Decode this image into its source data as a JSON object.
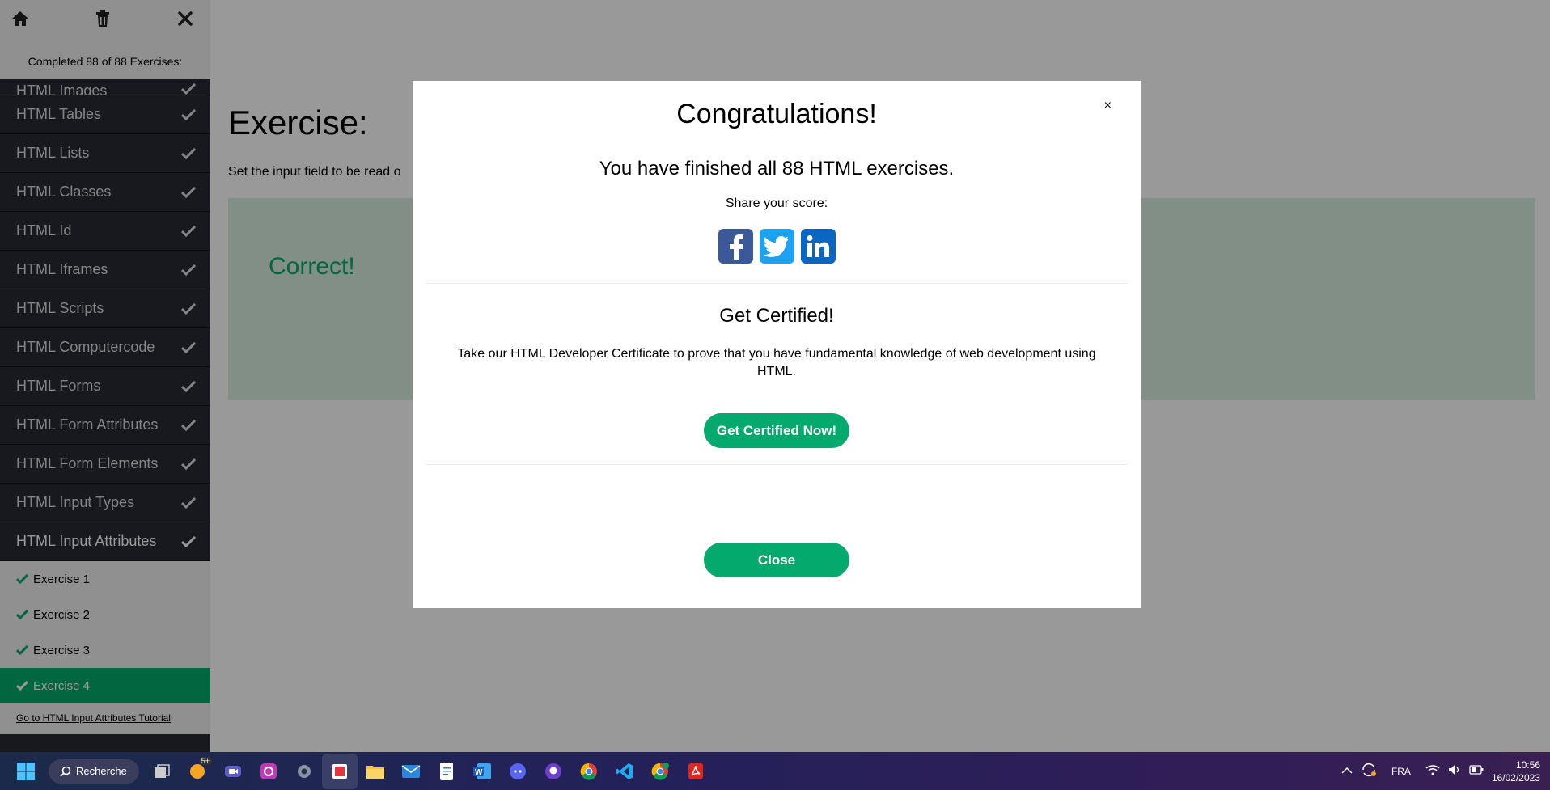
{
  "sidebar": {
    "completed_text": "Completed 88 of 88 Exercises:",
    "topics": [
      {
        "label": "HTML Images"
      },
      {
        "label": "HTML Tables"
      },
      {
        "label": "HTML Lists"
      },
      {
        "label": "HTML Classes"
      },
      {
        "label": "HTML Id"
      },
      {
        "label": "HTML Iframes"
      },
      {
        "label": "HTML Scripts"
      },
      {
        "label": "HTML Computercode"
      },
      {
        "label": "HTML Forms"
      },
      {
        "label": "HTML Form Attributes"
      },
      {
        "label": "HTML Form Elements"
      },
      {
        "label": "HTML Input Types"
      },
      {
        "label": "HTML Input Attributes"
      }
    ],
    "exercises": [
      {
        "label": "Exercise 1"
      },
      {
        "label": "Exercise 2"
      },
      {
        "label": "Exercise 3"
      },
      {
        "label": "Exercise 4"
      }
    ],
    "tutorial_link": "Go to HTML Input Attributes Tutorial"
  },
  "main": {
    "title": "Exercise:",
    "instruction": "Set the input field to be read o",
    "result": "Correct!"
  },
  "modal": {
    "close_x": "×",
    "title": "Congratulations!",
    "finished": "You have finished all 88 HTML exercises.",
    "share": "Share your score:",
    "cert_title": "Get Certified!",
    "cert_desc": "Take our HTML Developer Certificate to prove that you have fundamental knowledge of web development using HTML.",
    "cert_button": "Get Certified Now!",
    "close_button": "Close"
  },
  "taskbar": {
    "search_label": "Recherche",
    "lang": "FRA",
    "time": "10:56",
    "date": "16/02/2023",
    "badge": "5+"
  },
  "colors": {
    "accent": "#04aa6d",
    "sidebar_bg": "#282a35",
    "facebook": "#3b5998",
    "twitter": "#1da1f2",
    "linkedin": "#0a66c2"
  }
}
